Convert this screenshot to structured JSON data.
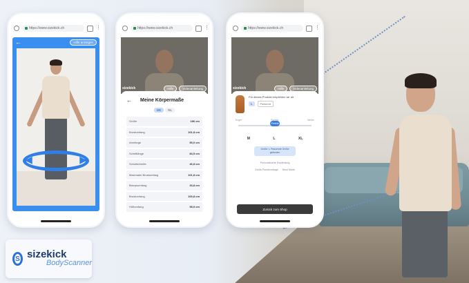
{
  "colors": {
    "accent": "#3a8ef0",
    "brand": "#2f6fd9",
    "cta": "#3b3b3b"
  },
  "browser": {
    "url": "https://www.sizekick.ch",
    "home_icon": "home-icon",
    "tabs_icon": "tabs-icon",
    "menu_icon": "more-vert-icon"
  },
  "phone1": {
    "header": {
      "back_icon": "arrow-left-icon",
      "help_label": "Hilfe anzeigen"
    },
    "rotate_icon": "rotate-arrows-icon"
  },
  "phone2": {
    "bar": {
      "logo": "sizekick",
      "chip1": "Hilfe",
      "chip2": "Videoanleitung"
    },
    "title": "Meine Körpermaße",
    "units": [
      "DE",
      "NL"
    ],
    "measurements": [
      {
        "label": "Größe",
        "value": "186 cm"
      },
      {
        "label": "Brustumfang",
        "value": "101,8 cm"
      },
      {
        "label": "Armlänge",
        "value": "59,0 cm"
      },
      {
        "label": "Schrittlänge",
        "value": "84,5 cm"
      },
      {
        "label": "Schulterbreite",
        "value": "46,8 cm"
      },
      {
        "label": "Maximaler Brustumfang",
        "value": "101,8 cm"
      },
      {
        "label": "Bizepsumfang",
        "value": "33,8 cm"
      },
      {
        "label": "Brustumfang",
        "value": "100,8 cm"
      },
      {
        "label": "Hüftumfang",
        "value": "98,9 cm"
      }
    ]
  },
  "phone3": {
    "bar": {
      "logo": "sizekick",
      "chip1": "Hilfe",
      "chip2": "Videoanleitung"
    },
    "rec_text": "Für dieses Produkt empfehlen wir dir",
    "size_selected": "L",
    "size_alt": "Passend",
    "fit_labels": [
      "Enger",
      "Perfekt",
      "Weiter"
    ],
    "fit_value": "Perfekt",
    "size_steps": [
      "M",
      "L",
      "XL"
    ],
    "notice": "Größe: L Passende Größe gefunden",
    "option": "Personalisierte Empfehlung",
    "options2": [
      "Größe Passformfrage",
      "Neue Maße"
    ],
    "cta": "Zurück zum Shop"
  },
  "badge": {
    "name": "sizekick",
    "sub": "BodyScanner"
  }
}
